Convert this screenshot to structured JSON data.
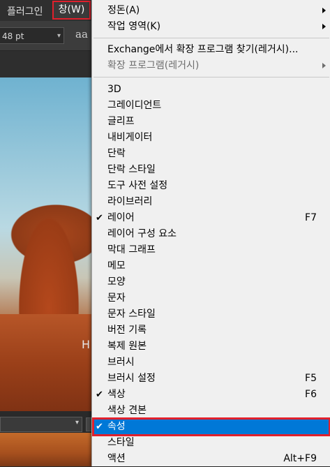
{
  "menubar": {
    "plugin_label": "플러그인",
    "window_label": "창(W)"
  },
  "options": {
    "font_size": "48 pt",
    "antialias_label": "aa"
  },
  "canvas": {
    "cursor_text": "H"
  },
  "menu": {
    "top": [
      {
        "label": "정돈(A)",
        "submenu": true
      },
      {
        "label": "작업 영역(K)",
        "submenu": true
      }
    ],
    "exchange": [
      {
        "label": "Exchange에서 확장 프로그램 찾기(레거시)...",
        "submenu": false
      },
      {
        "label": "확장 프로그램(레거시)",
        "submenu": true,
        "disabled": true
      }
    ],
    "panels": [
      {
        "label": "3D",
        "checked": false,
        "shortcut": ""
      },
      {
        "label": "그레이디언트",
        "checked": false,
        "shortcut": ""
      },
      {
        "label": "글리프",
        "checked": false,
        "shortcut": ""
      },
      {
        "label": "내비게이터",
        "checked": false,
        "shortcut": ""
      },
      {
        "label": "단락",
        "checked": false,
        "shortcut": ""
      },
      {
        "label": "단락 스타일",
        "checked": false,
        "shortcut": ""
      },
      {
        "label": "도구 사전 설정",
        "checked": false,
        "shortcut": ""
      },
      {
        "label": "라이브러리",
        "checked": false,
        "shortcut": ""
      },
      {
        "label": "레이어",
        "checked": true,
        "shortcut": "F7"
      },
      {
        "label": "레이어 구성 요소",
        "checked": false,
        "shortcut": ""
      },
      {
        "label": "막대 그래프",
        "checked": false,
        "shortcut": ""
      },
      {
        "label": "메모",
        "checked": false,
        "shortcut": ""
      },
      {
        "label": "모양",
        "checked": false,
        "shortcut": ""
      },
      {
        "label": "문자",
        "checked": false,
        "shortcut": ""
      },
      {
        "label": "문자 스타일",
        "checked": false,
        "shortcut": ""
      },
      {
        "label": "버전 기록",
        "checked": false,
        "shortcut": ""
      },
      {
        "label": "복제 원본",
        "checked": false,
        "shortcut": ""
      },
      {
        "label": "브러시",
        "checked": false,
        "shortcut": ""
      },
      {
        "label": "브러시 설정",
        "checked": false,
        "shortcut": "F5"
      },
      {
        "label": "색상",
        "checked": true,
        "shortcut": "F6"
      },
      {
        "label": "색상 견본",
        "checked": false,
        "shortcut": ""
      },
      {
        "label": "속성",
        "checked": true,
        "shortcut": "",
        "highlighted": true
      },
      {
        "label": "스타일",
        "checked": false,
        "shortcut": ""
      },
      {
        "label": "액션",
        "checked": false,
        "shortcut": "Alt+F9"
      }
    ],
    "check_glyph": "✔",
    "colors": {
      "highlight": "#0078d7",
      "outline": "#e0202c"
    }
  }
}
